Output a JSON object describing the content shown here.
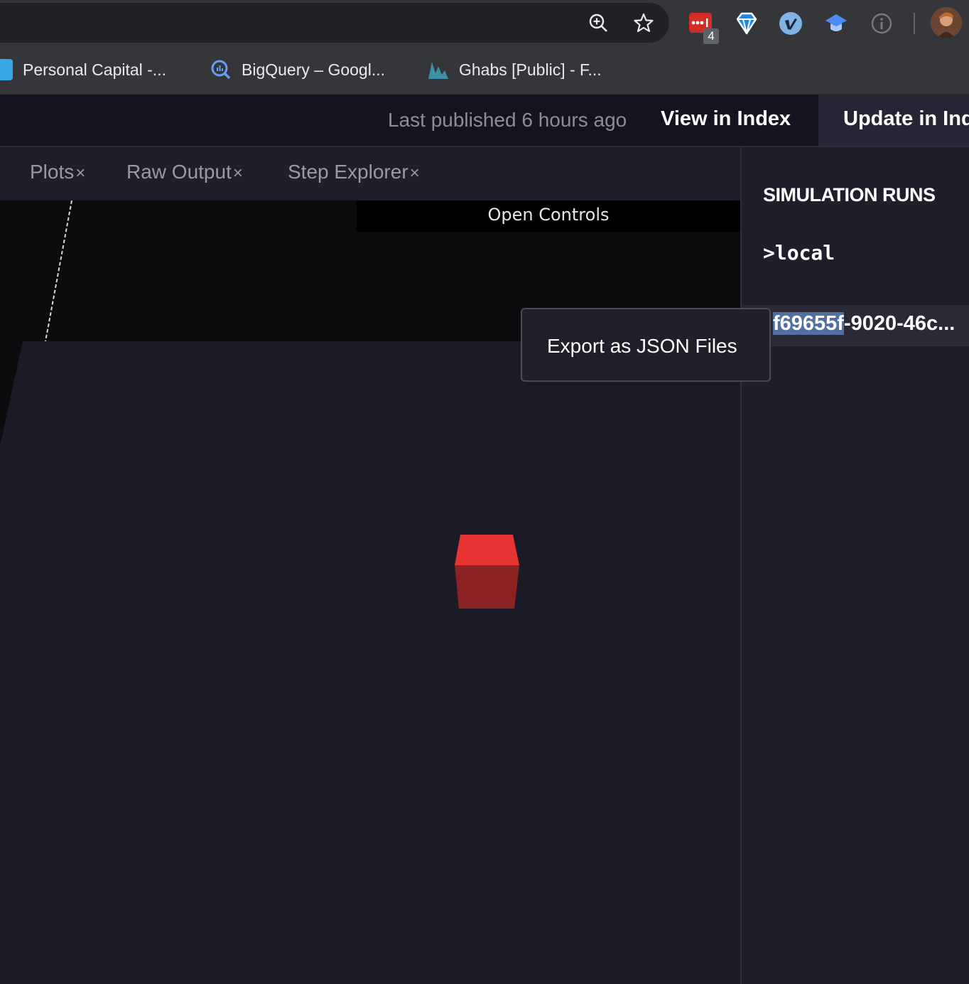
{
  "browser": {
    "ext_badge_count": "4",
    "bookmarks": [
      {
        "label": "Personal Capital -...",
        "icon": "personal-capital-icon"
      },
      {
        "label": "BigQuery – Googl...",
        "icon": "bigquery-icon"
      },
      {
        "label": "Ghabs [Public] - F...",
        "icon": "ghabs-icon"
      }
    ],
    "icons": [
      "zoom-icon",
      "bookmark-star-icon",
      "lastpass-icon",
      "diamond-extension-icon",
      "vimeo-icon",
      "graduation-cap-icon",
      "info-extension-icon",
      "profile-avatar-icon"
    ]
  },
  "header": {
    "last_published": "Last published 6 hours ago",
    "view_in_index": "View in Index",
    "update_in_index": "Update in Index"
  },
  "tabs": [
    {
      "label": "Plots",
      "close": "×"
    },
    {
      "label": "Raw Output",
      "close": "×"
    },
    {
      "label": "Step Explorer",
      "close": "×"
    }
  ],
  "viewport": {
    "open_controls": "Open Controls"
  },
  "sidebar": {
    "title": "SIMULATION RUNS",
    "local": ">local",
    "run_id_selected": "f69655f",
    "run_id_rest": "-9020-46c..."
  },
  "context_menu": {
    "export_label": "Export as JSON Files"
  },
  "colors": {
    "cube_top": "#e83333",
    "cube_front": "#8c2222",
    "floor": "#1b1b28",
    "selection": "#4f6fa0"
  }
}
